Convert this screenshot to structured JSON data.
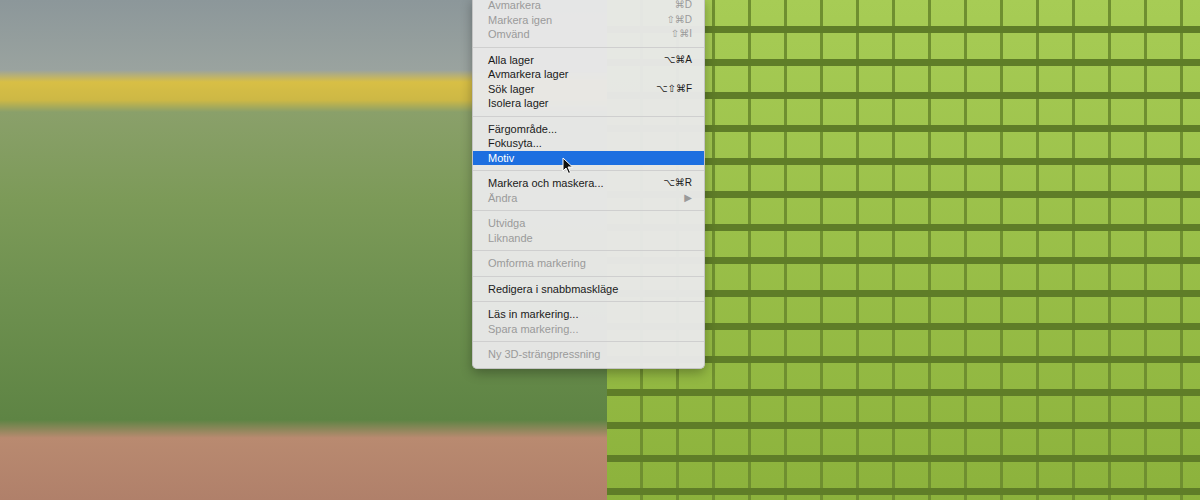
{
  "menu": {
    "groups": [
      [
        {
          "label": "Avmarkera",
          "shortcut": "⌘D",
          "disabled": true,
          "selected": false
        },
        {
          "label": "Markera igen",
          "shortcut": "⇧⌘D",
          "disabled": true,
          "selected": false
        },
        {
          "label": "Omvänd",
          "shortcut": "⇧⌘I",
          "disabled": true,
          "selected": false
        }
      ],
      [
        {
          "label": "Alla lager",
          "shortcut": "⌥⌘A",
          "disabled": false,
          "selected": false
        },
        {
          "label": "Avmarkera lager",
          "shortcut": "",
          "disabled": false,
          "selected": false
        },
        {
          "label": "Sök lager",
          "shortcut": "⌥⇧⌘F",
          "disabled": false,
          "selected": false
        },
        {
          "label": "Isolera lager",
          "shortcut": "",
          "disabled": false,
          "selected": false
        }
      ],
      [
        {
          "label": "Färgområde...",
          "shortcut": "",
          "disabled": false,
          "selected": false
        },
        {
          "label": "Fokusyta...",
          "shortcut": "",
          "disabled": false,
          "selected": false
        },
        {
          "label": "Motiv",
          "shortcut": "",
          "disabled": false,
          "selected": true
        }
      ],
      [
        {
          "label": "Markera och maskera...",
          "shortcut": "⌥⌘R",
          "disabled": false,
          "selected": false
        },
        {
          "label": "Ändra",
          "shortcut": "▶",
          "disabled": true,
          "selected": false
        }
      ],
      [
        {
          "label": "Utvidga",
          "shortcut": "",
          "disabled": true,
          "selected": false
        },
        {
          "label": "Liknande",
          "shortcut": "",
          "disabled": true,
          "selected": false
        }
      ],
      [
        {
          "label": "Omforma markering",
          "shortcut": "",
          "disabled": true,
          "selected": false
        }
      ],
      [
        {
          "label": "Redigera i snabbmaskläge",
          "shortcut": "",
          "disabled": false,
          "selected": false
        }
      ],
      [
        {
          "label": "Läs in markering...",
          "shortcut": "",
          "disabled": false,
          "selected": false
        },
        {
          "label": "Spara markering...",
          "shortcut": "",
          "disabled": true,
          "selected": false
        }
      ],
      [
        {
          "label": "Ny 3D-strängpressning",
          "shortcut": "",
          "disabled": true,
          "selected": false
        }
      ]
    ]
  }
}
